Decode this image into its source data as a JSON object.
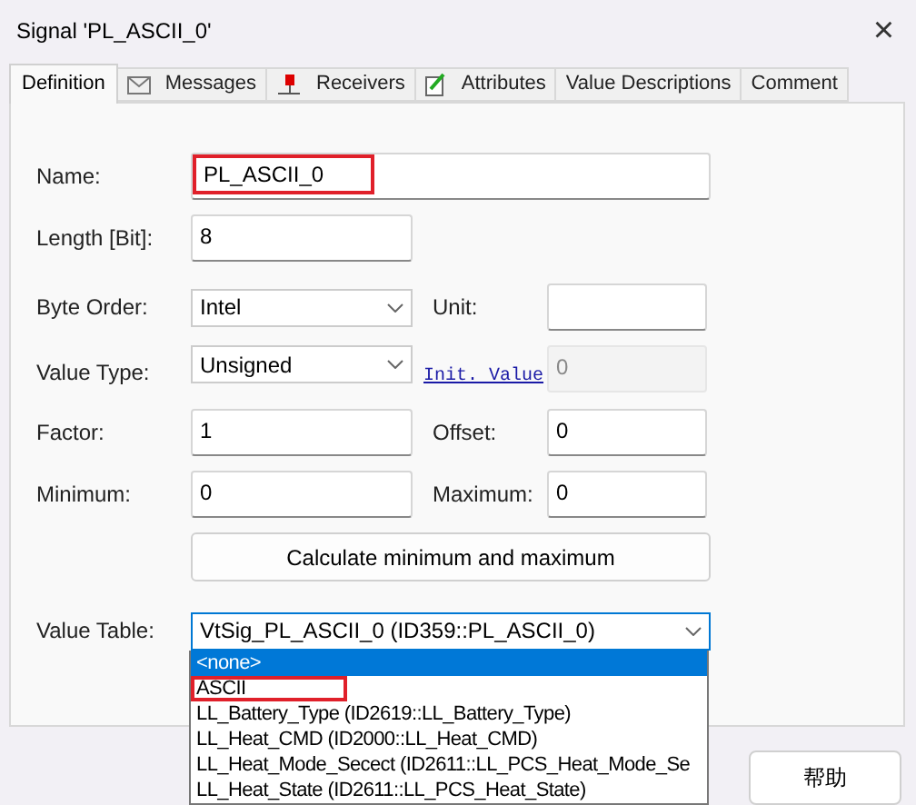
{
  "window": {
    "title": "Signal 'PL_ASCII_0'",
    "close": "×"
  },
  "tabs": [
    {
      "label": "Definition",
      "selected": true
    },
    {
      "label": "Messages",
      "selected": false
    },
    {
      "label": "Receivers",
      "selected": false
    },
    {
      "label": "Attributes",
      "selected": false
    },
    {
      "label": "Value Descriptions",
      "selected": false
    },
    {
      "label": "Comment",
      "selected": false
    }
  ],
  "form": {
    "name": {
      "label": "Name:",
      "value": "PL_ASCII_0",
      "highlighted": true
    },
    "length": {
      "label": "Length [Bit]:",
      "value": "8"
    },
    "byte_order": {
      "label": "Byte Order:",
      "value": "Intel"
    },
    "unit": {
      "label": "Unit:"
    },
    "value_type": {
      "label": "Value Type:",
      "value": "Unsigned"
    },
    "init_value": {
      "label": "Init. Value",
      "value": "0",
      "disabled": true
    },
    "factor": {
      "label": "Factor:",
      "value": "1"
    },
    "offset": {
      "label": "Offset:",
      "value": "0"
    },
    "minimum": {
      "label": "Minimum:",
      "value": "0"
    },
    "maximum": {
      "label": "Maximum:",
      "value": "0"
    },
    "calculate_button": "Calculate minimum and maximum",
    "value_table": {
      "label": "Value Table:",
      "value": "VtSig_PL_ASCII_0 (ID359::PL_ASCII_0)"
    }
  },
  "dropdown_list": [
    {
      "label": "<none>",
      "selected": true,
      "highlighted": false
    },
    {
      "label": "ASCII",
      "selected": false,
      "highlighted": true
    },
    {
      "label": "LL_Battery_Type (ID2619::LL_Battery_Type)",
      "selected": false,
      "highlighted": false
    },
    {
      "label": "LL_Heat_CMD (ID2000::LL_Heat_CMD)",
      "selected": false,
      "highlighted": false
    },
    {
      "label": "LL_Heat_Mode_Secect (ID2611::LL_PCS_Heat_Mode_Se",
      "selected": false,
      "highlighted": false
    },
    {
      "label": "LL_Heat_State (ID2611::LL_PCS_Heat_State)",
      "selected": false,
      "highlighted": false
    }
  ],
  "buttons": [
    {
      "label": "帮助"
    }
  ]
}
